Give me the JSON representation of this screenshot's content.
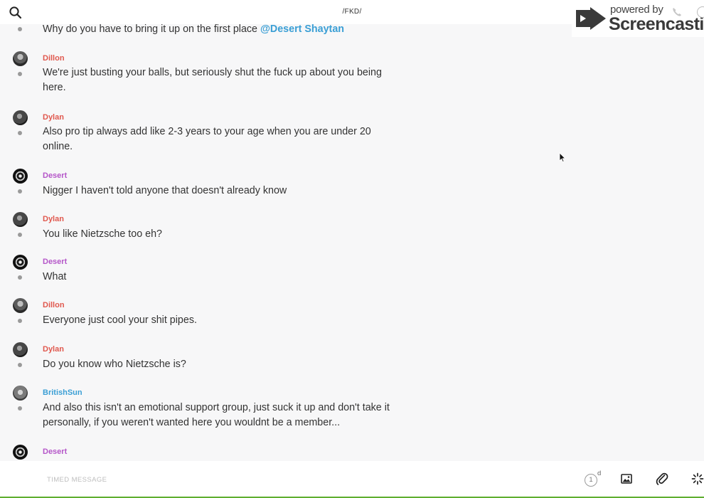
{
  "header": {
    "title": "/FKD/",
    "search_icon": "search-icon"
  },
  "watermark": {
    "powered": "powered by",
    "brand": "Screencastify"
  },
  "messages": [
    {
      "author": "",
      "text_before": "Why do you have to bring it up on the first place ",
      "mention": "@Desert Shaytan"
    },
    {
      "author": "Dillon",
      "text": "We're just busting your balls, but seriously shut the fuck up about you being here."
    },
    {
      "author": "Dylan",
      "text": "Also pro tip always add like 2-3 years to your age when you are under 20 online."
    },
    {
      "author": "Desert",
      "text": "Nigger I haven't told anyone that doesn't already know"
    },
    {
      "author": "Dylan",
      "text": "You like Nietzsche too eh?"
    },
    {
      "author": "Desert",
      "text": "What"
    },
    {
      "author": "Dillon",
      "text": "Everyone just cool your shit pipes."
    },
    {
      "author": "Dylan",
      "text": "Do you know who Nietzsche is?"
    },
    {
      "author": "BritishSun",
      "text": "And also this isn't an emotional support group, just suck it up and don't take it personally, if you weren't wanted here you wouldnt be a member..."
    },
    {
      "author": "Desert",
      "text": ""
    }
  ],
  "composer": {
    "placeholder": "TIMED MESSAGE",
    "timer_value": "1",
    "timer_unit": "d"
  },
  "colors": {
    "dillon": "#e0584e",
    "dylan": "#e0584e",
    "desert": "#b557c9",
    "britishsun": "#3b9fd5",
    "mention": "#3b9fd5",
    "bottom_bar_accent": "#5fae2f"
  }
}
